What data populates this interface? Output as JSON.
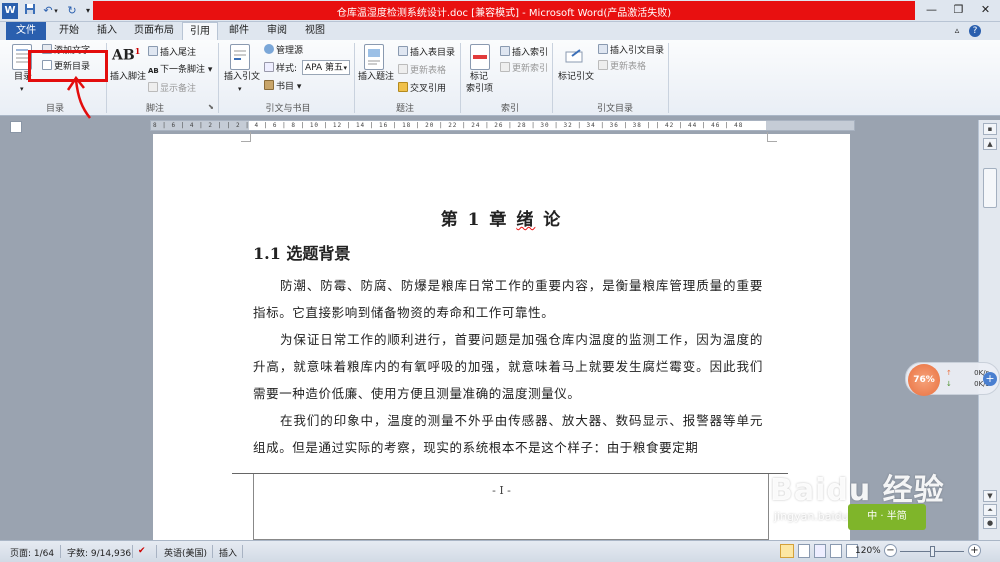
{
  "titlebar": {
    "title": "仓库温湿度检测系统设计.doc [兼容模式] - Microsoft Word(产品激活失败)",
    "app_icon": "W",
    "quick_access": [
      "save-icon",
      "undo-icon",
      "redo-icon",
      "customize-icon"
    ]
  },
  "tabs": {
    "file": "文件",
    "items": [
      "开始",
      "插入",
      "页面布局",
      "引用",
      "邮件",
      "审阅",
      "视图"
    ],
    "active": "引用"
  },
  "ribbon": {
    "toc": {
      "big": "目录",
      "add_text": "添加文字",
      "update_toc": "更新目录",
      "group": "目录"
    },
    "footnotes": {
      "insert_footnote": "插入脚注",
      "insert_endnote": "插入尾注",
      "next_footnote": "下一条脚注",
      "show_notes": "显示备注",
      "group": "脚注"
    },
    "citations": {
      "insert_citation": "插入引文",
      "manage_sources": "管理源",
      "style_label": "样式:",
      "style_value": "APA 第五",
      "bibliography": "书目",
      "group": "引文与书目"
    },
    "captions": {
      "insert_caption": "插入题注",
      "insert_table_of_figures": "插入表目录",
      "update_table": "更新表格",
      "cross_reference": "交叉引用",
      "group": "题注"
    },
    "index": {
      "mark_entry_1": "标记",
      "mark_entry_2": "索引项",
      "insert_index": "插入索引",
      "update_index": "更新索引",
      "group": "索引"
    },
    "authorities": {
      "mark_citation": "标记引文",
      "insert_toa": "插入引文目录",
      "update_table": "更新表格",
      "group": "引文目录"
    }
  },
  "ruler": {
    "ticks": "8 | 6 | 4 | 2 |   | 2 | 4 | 6 | 8 | 10 | 12 | 14 | 16 | 18 | 20 | 22 | 24 | 26 | 28 | 30 | 32 | 34 | 36 | 38 |   | 42 | 44 | 46 | 48"
  },
  "document": {
    "heading1_prefix": "第 1 章  ",
    "heading1_word": "绪",
    "heading1_suffix": "   论",
    "heading2": "1.1 选题背景",
    "paragraph1": "防潮、防霉、防腐、防爆是粮库日常工作的重要内容，是衡量粮库管理质量的重要指标。它直接影响到储备物资的寿命和工作可靠性。",
    "paragraph2": "为保证日常工作的顺利进行，首要问题是加强仓库内温度的监测工作，因为温度的升高，就意味着粮库内的有氧呼吸的加强，就意味着马上就要发生腐烂霉变。因此我们需要一种造价低廉、使用方便且测量准确的温度测量仪。",
    "paragraph3": "在我们的印象中，温度的测量不外乎由传感器、放大器、数码显示、报警器等单元组成。但是通过实际的考察，现实的系统根本不是这个样子：由于粮食要定期",
    "footer": "- I -"
  },
  "statusbar": {
    "page": "页面: 1/64",
    "words": "字数: 9/14,936",
    "language": "英语(美国)",
    "mode": "插入",
    "zoom": "120%"
  },
  "network_widget": {
    "percent": "76%",
    "up": "0K/s",
    "down": "0K/s"
  },
  "watermark": {
    "brand": "Baidu 经验",
    "url": "jingyan.baidu.com",
    "badge": "中 · 半简"
  },
  "colors": {
    "title_red": "#e81010",
    "file_tab": "#2a5fae",
    "highlight": "#e30d0d"
  }
}
